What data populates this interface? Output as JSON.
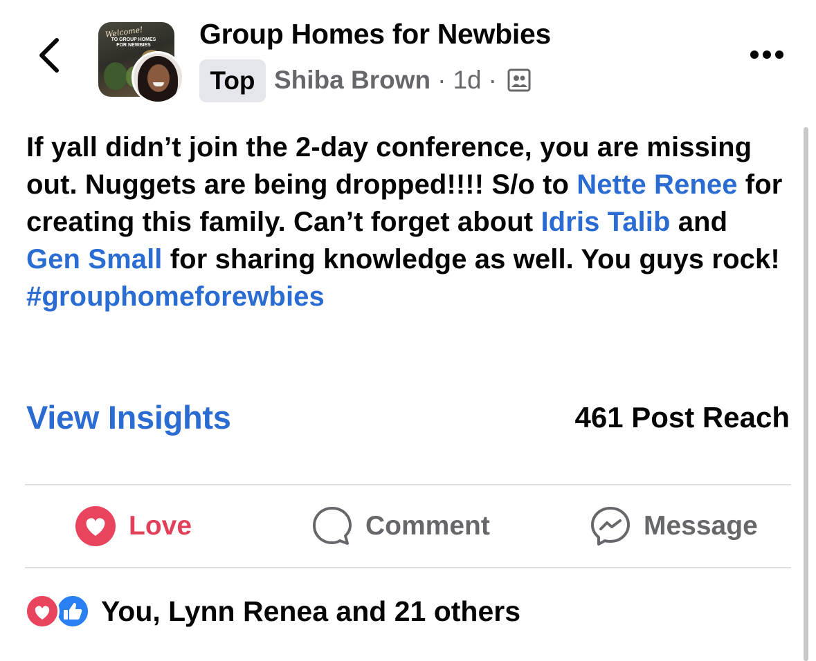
{
  "header": {
    "group_name": "Group Homes for Newbies",
    "group_avatar_text": {
      "welcome": "Welcome!",
      "name": "TO GROUP HOMES FOR NEWBIES"
    },
    "badge": "Top",
    "author": "Shiba Brown",
    "separator": "·",
    "time": "1d",
    "privacy_icon": "group-members-icon"
  },
  "post": {
    "segments": [
      {
        "text": "If yall didn’t join the 2-day conference, you are missing out. Nuggets are being dropped!!!! S/o to ",
        "link": false
      },
      {
        "text": "Nette Renee",
        "link": true
      },
      {
        "text": " for creating this family. Can’t forget about ",
        "link": false
      },
      {
        "text": "Idris Talib",
        "link": true
      },
      {
        "text": " and ",
        "link": false
      },
      {
        "text": "Gen Small",
        "link": true
      },
      {
        "text": " for sharing knowledge as well. You guys rock! ",
        "link": false
      },
      {
        "text": "#grouphomeforewbies",
        "link": true
      }
    ]
  },
  "insights": {
    "link_label": "View Insights",
    "reach": "461 Post Reach"
  },
  "actions": {
    "love": "Love",
    "comment": "Comment",
    "message": "Message"
  },
  "reactions": {
    "summary": "You, Lynn Renea and 21 others",
    "icons": [
      "heart-reaction-icon",
      "like-reaction-icon"
    ]
  },
  "colors": {
    "link": "#2a6cd1",
    "love": "#e0405a",
    "muted": "#65676b",
    "badge_bg": "#e4e6eb",
    "like_blue": "#2a80f0"
  }
}
